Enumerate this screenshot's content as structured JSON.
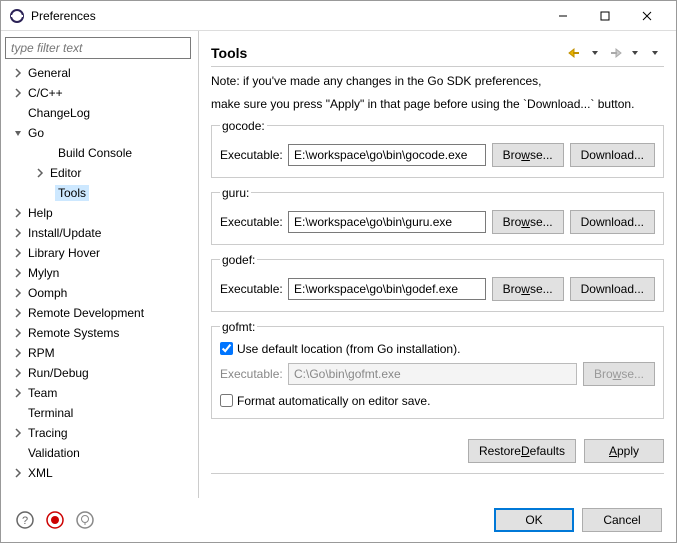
{
  "window": {
    "title": "Preferences"
  },
  "filter": {
    "placeholder": "type filter text"
  },
  "tree": [
    {
      "label": "General",
      "depth": 1,
      "arrow": "right"
    },
    {
      "label": "C/C++",
      "depth": 1,
      "arrow": "right"
    },
    {
      "label": "ChangeLog",
      "depth": 1,
      "arrow": "none"
    },
    {
      "label": "Go",
      "depth": 1,
      "arrow": "down"
    },
    {
      "label": "Build Console",
      "depth": 2,
      "arrow": "none"
    },
    {
      "label": "Editor",
      "depth": 2,
      "arrow": "right",
      "indent": true
    },
    {
      "label": "Tools",
      "depth": 2,
      "arrow": "none",
      "selected": true
    },
    {
      "label": "Help",
      "depth": 1,
      "arrow": "right"
    },
    {
      "label": "Install/Update",
      "depth": 1,
      "arrow": "right"
    },
    {
      "label": "Library Hover",
      "depth": 1,
      "arrow": "right"
    },
    {
      "label": "Mylyn",
      "depth": 1,
      "arrow": "right"
    },
    {
      "label": "Oomph",
      "depth": 1,
      "arrow": "right"
    },
    {
      "label": "Remote Development",
      "depth": 1,
      "arrow": "right"
    },
    {
      "label": "Remote Systems",
      "depth": 1,
      "arrow": "right"
    },
    {
      "label": "RPM",
      "depth": 1,
      "arrow": "right"
    },
    {
      "label": "Run/Debug",
      "depth": 1,
      "arrow": "right"
    },
    {
      "label": "Team",
      "depth": 1,
      "arrow": "right"
    },
    {
      "label": "Terminal",
      "depth": 1,
      "arrow": "none"
    },
    {
      "label": "Tracing",
      "depth": 1,
      "arrow": "right"
    },
    {
      "label": "Validation",
      "depth": 1,
      "arrow": "none"
    },
    {
      "label": "XML",
      "depth": 1,
      "arrow": "right"
    }
  ],
  "page": {
    "title": "Tools",
    "note1": "Note: if you've made any changes in the Go SDK preferences,",
    "note2": "make sure you press \"Apply\" in that page before using the `Download...` button.",
    "exec_label": "Executable:",
    "browse": "Browse...",
    "download": "Download...",
    "gocode": {
      "legend": "gocode:",
      "value": "E:\\workspace\\go\\bin\\gocode.exe"
    },
    "guru": {
      "legend": "guru:",
      "value": "E:\\workspace\\go\\bin\\guru.exe"
    },
    "godef": {
      "legend": "godef:",
      "value": "E:\\workspace\\go\\bin\\godef.exe"
    },
    "gofmt": {
      "legend": "gofmt:",
      "use_default": "Use default location (from Go installation).",
      "value": "C:\\Go\\bin\\gofmt.exe",
      "auto_format": "Format automatically on editor save."
    },
    "restore": "Restore Defaults",
    "apply": "Apply"
  },
  "footer": {
    "ok": "OK",
    "cancel": "Cancel"
  }
}
